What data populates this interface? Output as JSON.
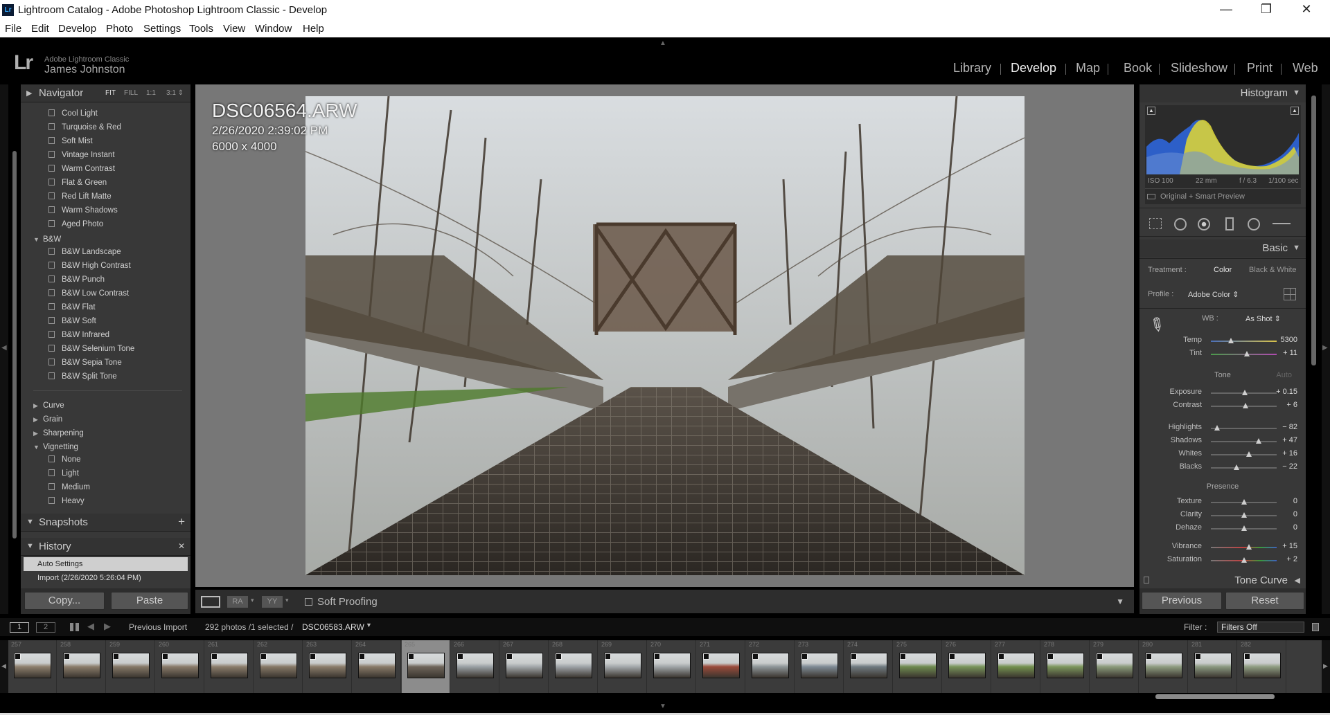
{
  "window": {
    "title": "Lightroom Catalog - Adobe Photoshop Lightroom Classic - Develop",
    "app_icon": "Lr",
    "minimize": "—",
    "restore": "❐",
    "close": "✕"
  },
  "menu": [
    "File",
    "Edit",
    "Develop",
    "Photo",
    "Settings",
    "Tools",
    "View",
    "Window",
    "Help"
  ],
  "identity": {
    "logo": "Lr",
    "product": "Adobe Lightroom Classic",
    "user": "James Johnston"
  },
  "modules": [
    "Library",
    "Develop",
    "Map",
    "Book",
    "Slideshow",
    "Print",
    "Web"
  ],
  "active_module": "Develop",
  "navigator": {
    "label": "Navigator",
    "options": [
      "FIT",
      "FILL",
      "1:1",
      "3:1 ⇕"
    ]
  },
  "presets": {
    "items_a": [
      "Cool Light",
      "Turquoise & Red",
      "Soft Mist",
      "Vintage Instant",
      "Warm Contrast",
      "Flat & Green",
      "Red Lift Matte",
      "Warm Shadows",
      "Aged Photo"
    ],
    "group_bw": "B&W",
    "items_bw": [
      "B&W Landscape",
      "B&W High Contrast",
      "B&W Punch",
      "B&W Low Contrast",
      "B&W Flat",
      "B&W Soft",
      "B&W Infrared",
      "B&W Selenium Tone",
      "B&W Sepia Tone",
      "B&W Split Tone"
    ],
    "groups_collapsed": [
      "Curve",
      "Grain",
      "Sharpening"
    ],
    "group_vignetting": "Vignetting",
    "items_vig": [
      "None",
      "Light",
      "Medium",
      "Heavy"
    ]
  },
  "snapshots": {
    "label": "Snapshots",
    "add": "+"
  },
  "history": {
    "label": "History",
    "close": "✕",
    "items": [
      "Auto Settings",
      "Import (2/26/2020 5:26:04 PM)"
    ]
  },
  "left_buttons": {
    "copy": "Copy...",
    "paste": "Paste"
  },
  "image_info": {
    "filename": "DSC06564.ARW",
    "datetime": "2/26/2020 2:39:02 PM",
    "dimensions": "6000 x 4000"
  },
  "toolbar": {
    "soft_proofing": "Soft Proofing",
    "view_ra": "RA",
    "view_yy": "YY"
  },
  "histogram": {
    "label": "Histogram",
    "iso": "ISO 100",
    "focal": "22 mm",
    "aperture": "f / 6.3",
    "shutter": "1/100 sec",
    "preview_status": "Original + Smart Preview"
  },
  "basic": {
    "label": "Basic",
    "treatment_label": "Treatment :",
    "treatment_color": "Color",
    "treatment_bw": "Black & White",
    "profile_label": "Profile :",
    "profile_value": "Adobe Color ⇕",
    "wb_label": "WB :",
    "wb_value": "As Shot ⇕",
    "tone_label": "Tone",
    "auto_label": "Auto",
    "presence_label": "Presence",
    "sliders": [
      {
        "name": "Temp",
        "value": "5300",
        "pos": 0.3
      },
      {
        "name": "Tint",
        "value": "+ 11",
        "pos": 0.55
      },
      {
        "name": "Exposure",
        "value": "+ 0.15",
        "pos": 0.52
      },
      {
        "name": "Contrast",
        "value": "+ 6",
        "pos": 0.53
      },
      {
        "name": "Highlights",
        "value": "− 82",
        "pos": 0.09
      },
      {
        "name": "Shadows",
        "value": "+ 47",
        "pos": 0.73
      },
      {
        "name": "Whites",
        "value": "+ 16",
        "pos": 0.58
      },
      {
        "name": "Blacks",
        "value": "− 22",
        "pos": 0.39
      },
      {
        "name": "Texture",
        "value": "0",
        "pos": 0.5
      },
      {
        "name": "Clarity",
        "value": "0",
        "pos": 0.5
      },
      {
        "name": "Dehaze",
        "value": "0",
        "pos": 0.5
      },
      {
        "name": "Vibrance",
        "value": "+ 15",
        "pos": 0.575
      },
      {
        "name": "Saturation",
        "value": "+ 2",
        "pos": 0.51
      }
    ]
  },
  "tone_curve": {
    "label": "Tone Curve"
  },
  "right_buttons": {
    "previous": "Previous",
    "reset": "Reset"
  },
  "filmstrip_bar": {
    "screen1": "1",
    "screen2": "2",
    "source": "Previous Import",
    "count": "292 photos /1 selected /",
    "current_file": "DSC06583.ARW",
    "filter_label": "Filter :",
    "filter_value": "Filters Off"
  },
  "filmstrip": {
    "numbers": [
      "257",
      "258",
      "259",
      "260",
      "261",
      "262",
      "263",
      "264",
      "265",
      "266",
      "267",
      "268",
      "269",
      "270",
      "271",
      "272",
      "273",
      "274",
      "275",
      "276",
      "277",
      "278",
      "279",
      "280",
      "281",
      "282"
    ],
    "selected_index": 8
  },
  "colors": {
    "accent": "#f0f0f0",
    "panel": "#383838",
    "canvas": "#777777"
  }
}
